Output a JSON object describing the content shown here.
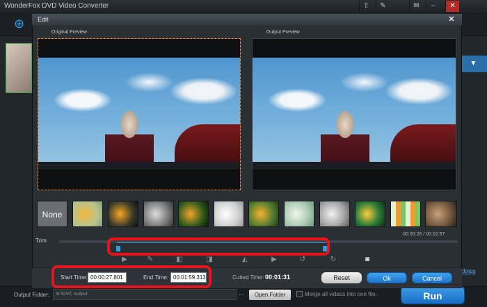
{
  "app": {
    "title": "WonderFox DVD Video Converter"
  },
  "dialog": {
    "title": "Edit",
    "original_label": "Original Preview",
    "output_label": "Output Preview",
    "effect_none_label": "None",
    "trim_label": "Trim",
    "time_readout": "00:00:26 / 00:02:57",
    "start_time_label": "Start Time:",
    "start_time_value": "00:00:27.801",
    "end_time_label": "End Time:",
    "end_time_value": "00:01:59.313",
    "cutted_time_label": "Cutted Time:",
    "cutted_time_value": "00:01:31",
    "reset_label": "Reset",
    "ok_label": "Ok",
    "cancel_label": "Cancel"
  },
  "main": {
    "settings_link": "ettings",
    "output_folder_label": "Output Folder:",
    "output_folder_value": "E:\\DVC output",
    "output_browse": "...",
    "open_folder_label": "Open Folder",
    "merge_label": "Merge all videos into one file.",
    "run_label": "Run"
  },
  "icons": {
    "titlebar": [
      "upload-icon",
      "wrench-icon",
      "chat-icon",
      "minimize-icon",
      "close-icon"
    ],
    "controls": [
      "play-icon",
      "edit-icon",
      "mark-in-icon",
      "mark-out-icon",
      "flip-icon",
      "next-icon",
      "rotate-left-icon",
      "rotate-right-icon",
      "snapshot-icon"
    ]
  },
  "colors": {
    "accent": "#2f9fe0",
    "highlight": "#e8141c",
    "run": "#1b6ec4"
  }
}
